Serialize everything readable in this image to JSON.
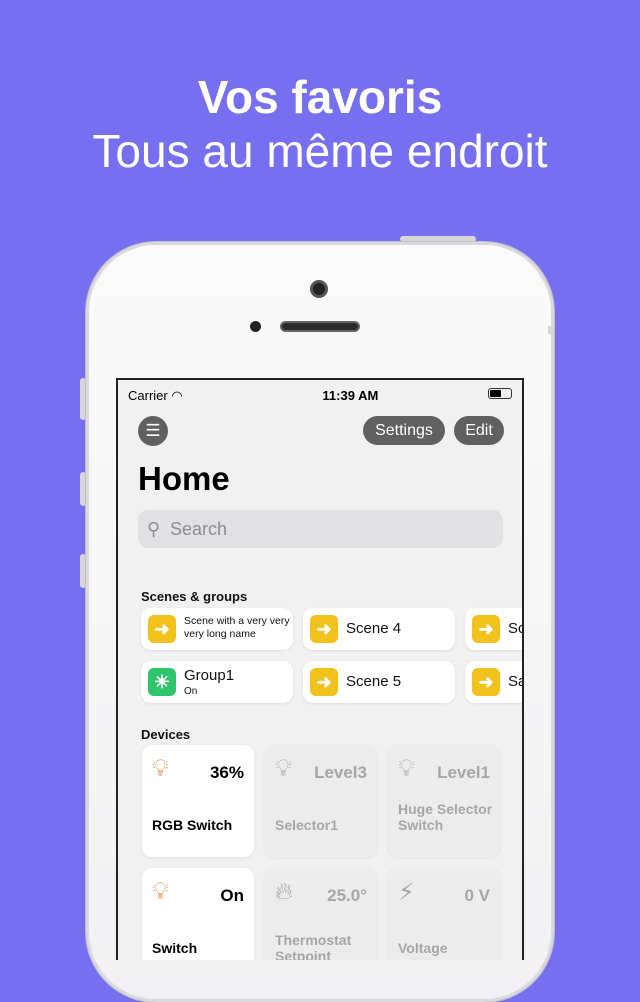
{
  "headline": "Vos favoris",
  "subheadline": "Tous au même endroit",
  "status": {
    "carrier": "Carrier",
    "time": "11:39 AM"
  },
  "toolbar": {
    "settings": "Settings",
    "edit": "Edit"
  },
  "page_title": "Home",
  "search": {
    "placeholder": "Search"
  },
  "scenes_title": "Scenes & groups",
  "scenes": [
    {
      "name": "Scene with a very very very long name",
      "icon": "arrow-right-icon"
    },
    {
      "name": "Scene 4",
      "icon": "arrow-right-icon"
    },
    {
      "name": "Sc",
      "icon": "arrow-right-icon"
    },
    {
      "name": "Group1",
      "sub": "On",
      "icon": "sun-icon"
    },
    {
      "name": "Scene 5",
      "icon": "arrow-right-icon"
    },
    {
      "name": "Sa",
      "icon": "arrow-right-icon"
    }
  ],
  "devices_title": "Devices",
  "devices": [
    {
      "name": "RGB Switch",
      "value": "36%",
      "icon": "lightbulb-icon",
      "active": true
    },
    {
      "name": "Selector1",
      "value": "Level3",
      "icon": "lightbulb-icon",
      "active": false
    },
    {
      "name": "Huge Selector Switch",
      "value": "Level1",
      "icon": "lightbulb-icon",
      "active": false
    },
    {
      "name": "Switch",
      "value": "On",
      "icon": "lightbulb-icon",
      "active": true
    },
    {
      "name": "Thermostat Setpoint",
      "value": "25.0°",
      "icon": "flame-icon",
      "active": false
    },
    {
      "name": "Voltage",
      "value": "0 V",
      "icon": "bolt-icon",
      "active": false
    }
  ],
  "colors": {
    "background": "#766ff0",
    "scene": "#f1c21b",
    "group": "#2fc46c",
    "bulb_on": "#e8762c"
  }
}
